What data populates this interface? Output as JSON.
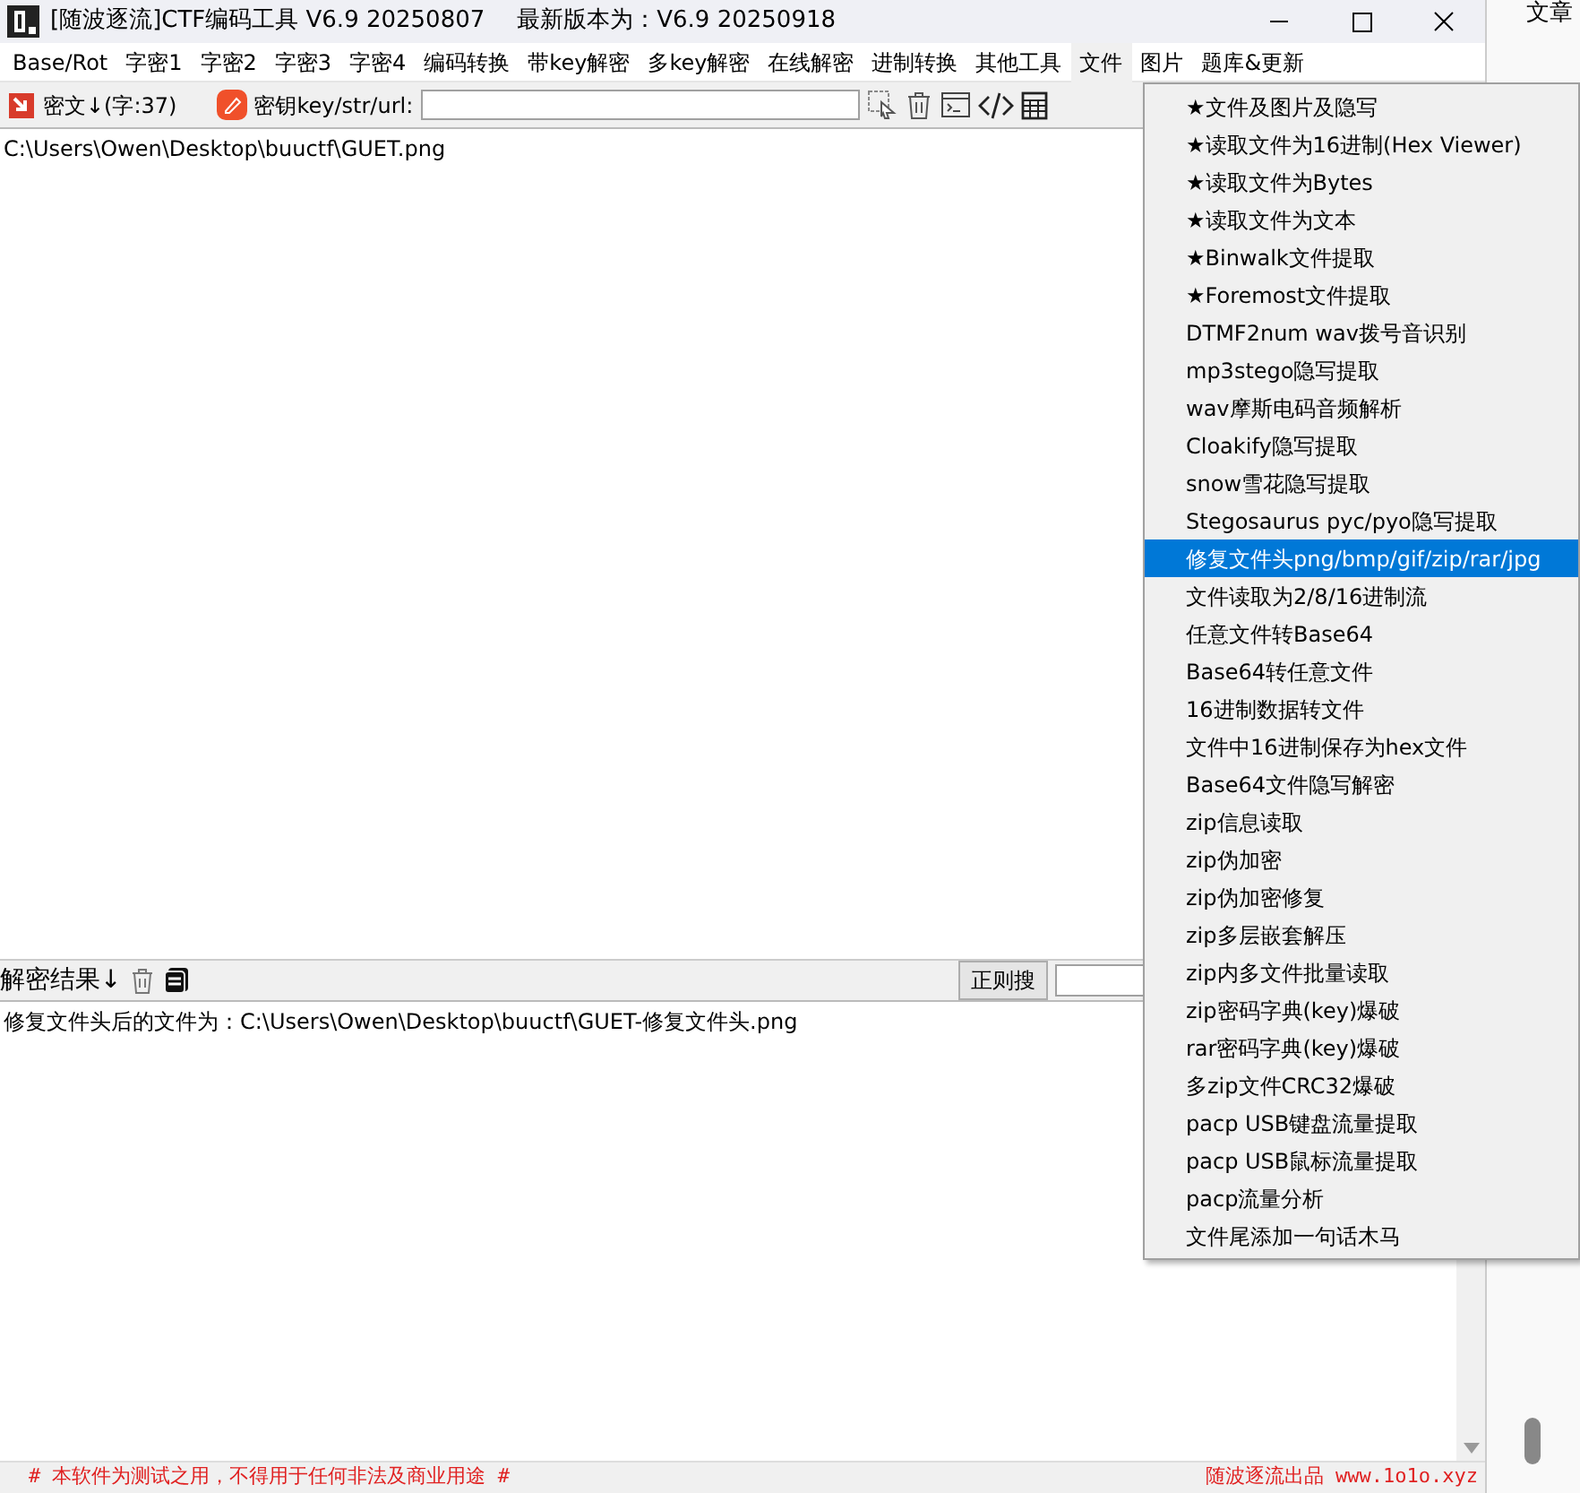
{
  "window": {
    "title": "[随波逐流]CTF编码工具 V6.9 20250807",
    "version_note": "最新版本为：V6.9  20250918"
  },
  "menu": [
    {
      "label": "Base/Rot",
      "selected": false
    },
    {
      "label": "字密1",
      "selected": false
    },
    {
      "label": "字密2",
      "selected": false
    },
    {
      "label": "字密3",
      "selected": false
    },
    {
      "label": "字密4",
      "selected": false
    },
    {
      "label": "编码转换",
      "selected": false
    },
    {
      "label": "带key解密",
      "selected": false
    },
    {
      "label": "多key解密",
      "selected": false
    },
    {
      "label": "在线解密",
      "selected": false
    },
    {
      "label": "进制转换",
      "selected": false
    },
    {
      "label": "其他工具",
      "selected": false
    },
    {
      "label": "文件",
      "selected": true
    },
    {
      "label": "图片",
      "selected": false
    },
    {
      "label": "题库&更新",
      "selected": false
    }
  ],
  "toolbar": {
    "cipher_label": "密文↓(字:37)",
    "key_label": "密钥key/str/url:"
  },
  "input_text": "C:\\Users\\Owen\\Desktop\\buuctf\\GUET.png",
  "result_bar": {
    "label": "解密结果↓",
    "search_button": "正则搜"
  },
  "result_text": "修复文件头后的文件为：C:\\Users\\Owen\\Desktop\\buuctf\\GUET-修复文件头.png",
  "status_bar": {
    "left": "# 本软件为测试之用，不得用于任何非法及商业用途 #",
    "right": "随波逐流出品 www.1o1o.xyz"
  },
  "side_text": "文章",
  "file_menu": [
    {
      "label": "★文件及图片及隐写",
      "selected": false
    },
    {
      "label": "★读取文件为16进制(Hex Viewer)",
      "selected": false
    },
    {
      "label": "★读取文件为Bytes",
      "selected": false
    },
    {
      "label": "★读取文件为文本",
      "selected": false
    },
    {
      "label": "★Binwalk文件提取",
      "selected": false
    },
    {
      "label": "★Foremost文件提取",
      "selected": false
    },
    {
      "label": "DTMF2num  wav拨号音识别",
      "selected": false
    },
    {
      "label": "mp3stego隐写提取",
      "selected": false
    },
    {
      "label": "wav摩斯电码音频解析",
      "selected": false
    },
    {
      "label": "Cloakify隐写提取",
      "selected": false
    },
    {
      "label": "snow雪花隐写提取",
      "selected": false
    },
    {
      "label": "Stegosaurus pyc/pyo隐写提取",
      "selected": false
    },
    {
      "label": "修复文件头png/bmp/gif/zip/rar/jpg",
      "selected": true
    },
    {
      "label": "文件读取为2/8/16进制流",
      "selected": false
    },
    {
      "label": "任意文件转Base64",
      "selected": false
    },
    {
      "label": "Base64转任意文件",
      "selected": false
    },
    {
      "label": "16进制数据转文件",
      "selected": false
    },
    {
      "label": "文件中16进制保存为hex文件",
      "selected": false
    },
    {
      "label": "Base64文件隐写解密",
      "selected": false
    },
    {
      "label": "zip信息读取",
      "selected": false
    },
    {
      "label": "zip伪加密",
      "selected": false
    },
    {
      "label": "zip伪加密修复",
      "selected": false
    },
    {
      "label": "zip多层嵌套解压",
      "selected": false
    },
    {
      "label": "zip内多文件批量读取",
      "selected": false
    },
    {
      "label": "zip密码字典(key)爆破",
      "selected": false
    },
    {
      "label": "rar密码字典(key)爆破",
      "selected": false
    },
    {
      "label": "多zip文件CRC32爆破",
      "selected": false
    },
    {
      "label": "pacp USB键盘流量提取",
      "selected": false
    },
    {
      "label": "pacp USB鼠标流量提取",
      "selected": false
    },
    {
      "label": "pacp流量分析",
      "selected": false
    },
    {
      "label": "文件尾添加一句话木马",
      "selected": false
    }
  ]
}
